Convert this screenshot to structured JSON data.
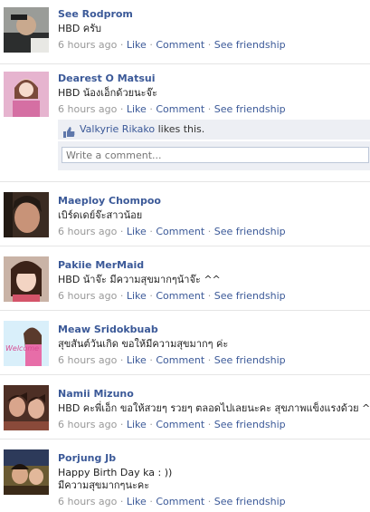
{
  "actions": {
    "like": "Like",
    "comment": "Comment",
    "friendship": "See friendship",
    "sep": "·"
  },
  "posts": [
    {
      "name": "See Rodprom",
      "message": "HBD ครับ",
      "time": "6 hours ago"
    },
    {
      "name": "Dearest O Matsui",
      "message": "HBD น้องเอ็กด้วยนะจ๊ะ",
      "time": "6 hours ago"
    },
    {
      "name": "Maeploy Chompoo",
      "message": "เบิร์ดเดย์จ๊ะสาวน้อย",
      "time": "6 hours ago"
    },
    {
      "name": "Pakiie MerMaid",
      "message": "HBD น้าจ๊ะ มีความสุขมากๆน้าจ๊ะ ^^",
      "time": "6 hours ago"
    },
    {
      "name": "Meaw Sridokbuab",
      "message": "สุขสันต์วันเกิด ขอให้มีความสุขมากๆ ค่ะ",
      "time": "6 hours ago",
      "avatar_text": "Welcome"
    },
    {
      "name": "Namii Mizuno",
      "message": "HBD คะพี่เอ็ก ขอให้สวยๆ รวยๆ ตลอดไปเลยนะคะ สุขภาพแข็งแรงด้วย ^^",
      "time": "6 hours ago"
    },
    {
      "name": "Porjung Jb",
      "message": "Happy Birth Day ka : ))",
      "message2": "มีความสุขมากๆนะคะ",
      "time": "6 hours ago"
    }
  ],
  "likes_box": {
    "liker": "Valkyrie Rikako",
    "suffix": " likes this."
  },
  "comment_box": {
    "placeholder": "Write a comment..."
  },
  "colors": {
    "link": "#3b5998",
    "meta": "#999999",
    "panel": "#edeff4"
  }
}
